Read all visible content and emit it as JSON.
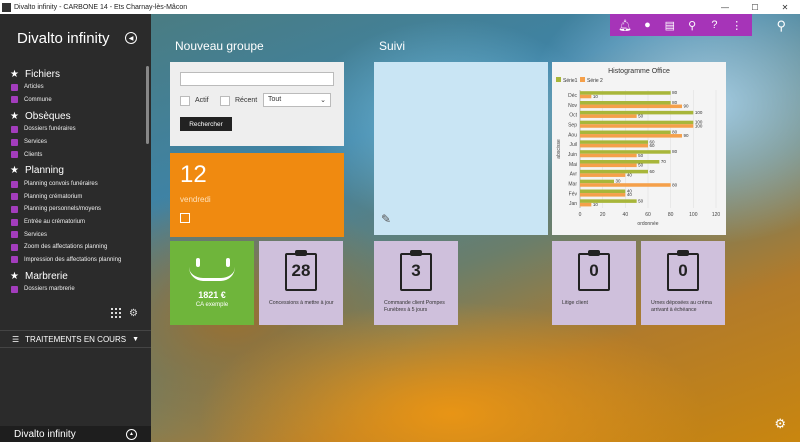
{
  "window": {
    "title": "Divalto infinity - CARBONE 14 - Ets Charnay-lès-Mâcon",
    "minimize": "—",
    "maximize": "☐",
    "close": "✕"
  },
  "sidebar": {
    "brand": "Divalto infinity",
    "sections": [
      {
        "title": "Fichiers",
        "items": [
          "Articles",
          "Commune"
        ]
      },
      {
        "title": "Obsèques",
        "items": [
          "Dossiers funéraires",
          "Services",
          "Clients"
        ]
      },
      {
        "title": "Planning",
        "items": [
          "Planning convois funéraires",
          "Planning crématorium",
          "Planning personnels/moyens",
          "Entrée au crématorium",
          "Services",
          "Zoom des affectations planning",
          "Impression des affectations planning"
        ]
      },
      {
        "title": "Marbrerie",
        "items": [
          "Dossiers marbrerie"
        ]
      }
    ],
    "traitements": "TRAITEMENTS EN COURS",
    "footer": "Divalto infinity"
  },
  "toolbar": {
    "icons": [
      "bell-icon",
      "user-icon",
      "printer-icon",
      "search-person-icon",
      "help-icon",
      "more-icon"
    ]
  },
  "groups": {
    "left": "Nouveau groupe",
    "right": "Suivi"
  },
  "search_tile": {
    "actif": "Actif",
    "recent": "Récent",
    "select_value": "Tout",
    "button": "Rechercher"
  },
  "date_tile": {
    "day": "12",
    "weekday": "vendredi"
  },
  "ca_tile": {
    "amount": "1821 €",
    "label": "CA exemple"
  },
  "counters": [
    {
      "value": "28",
      "label": "Concessions à mettre à jour"
    },
    {
      "value": "3",
      "label": "Commande client Pompes Funèbres à 5 jours"
    },
    {
      "value": "0",
      "label": "Litige client"
    },
    {
      "value": "0",
      "label": "Urnes déposées au créma arrivant à échéance"
    }
  ],
  "colors": {
    "accent": "#a634b8",
    "serie1": "#a8b63a",
    "serie2": "#f5a04a"
  },
  "chart_data": {
    "type": "bar",
    "orientation": "horizontal",
    "title": "Histogramme Office",
    "xlabel": "ordonnée",
    "ylabel": "abscisse",
    "xlim": [
      0,
      120
    ],
    "xticks": [
      0,
      20,
      40,
      60,
      80,
      100,
      120
    ],
    "categories": [
      "Déc",
      "Nov",
      "Oct",
      "Sep",
      "Aou",
      "Juil",
      "Juin",
      "Mai",
      "Avr",
      "Mar",
      "Fév",
      "Jan"
    ],
    "legend": "top-left",
    "series": [
      {
        "name": "Série1",
        "values": [
          80,
          80,
          100,
          100,
          80,
          60,
          80,
          70,
          60,
          30,
          40,
          50
        ]
      },
      {
        "name": "Série 2",
        "values": [
          10,
          90,
          50,
          100,
          90,
          60,
          50,
          50,
          40,
          80,
          40,
          10
        ]
      }
    ]
  }
}
